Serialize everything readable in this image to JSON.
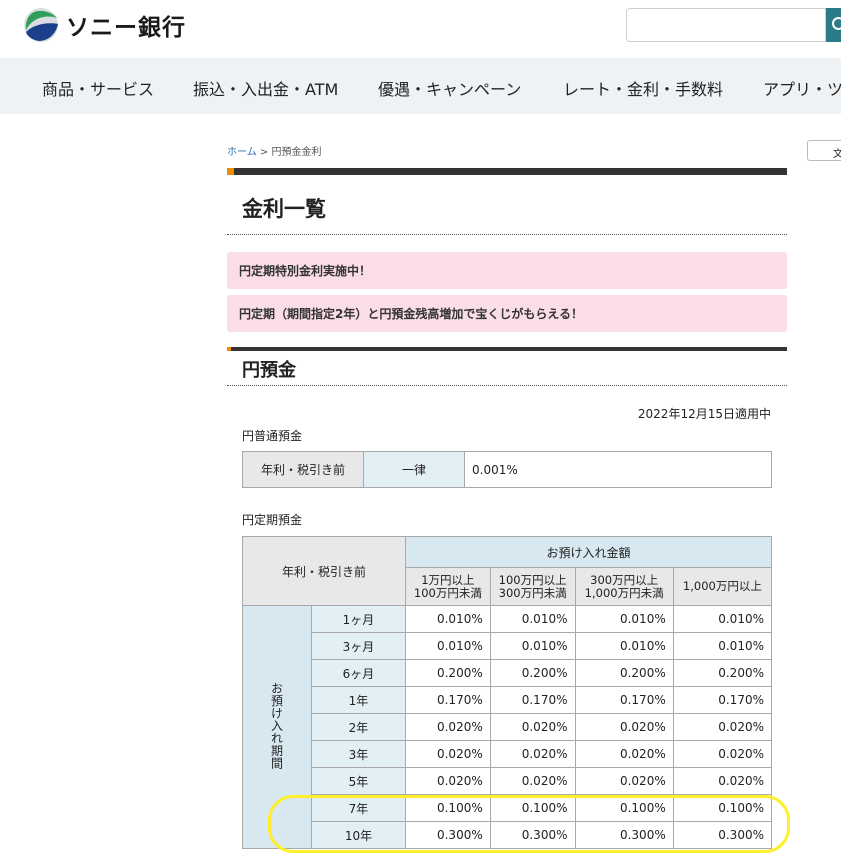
{
  "header": {
    "logo_text": "ソニー銀行",
    "search_placeholder": ""
  },
  "nav": {
    "items": [
      "商品・サービス",
      "振込・入出金・ATM",
      "優遇・キャンペーン",
      "レート・金利・手数料",
      "アプリ・ツ"
    ]
  },
  "side_button_label": "文",
  "breadcrumb": {
    "home": "ホーム",
    "separator": ">",
    "current": "円預金金利"
  },
  "page_title": "金利一覧",
  "notices": [
    "円定期特別金利実施中！",
    "円定期（期間指定2年）と円預金残高増加で宝くじがもらえる！"
  ],
  "section": {
    "title": "円預金",
    "date": "2022年12月15日適用中"
  },
  "ordinary": {
    "title": "円普通預金",
    "header": "年利・税引き前",
    "label": "一律",
    "rate": "0.001%"
  },
  "fixed": {
    "title": "円定期預金",
    "header": "年利・税引き前",
    "amount_header": "お預け入れ金額",
    "period_header": "お預け入れ期間",
    "columns": [
      {
        "line1": "1万円以上",
        "line2": "100万円未満"
      },
      {
        "line1": "100万円以上",
        "line2": "300万円未満"
      },
      {
        "line1": "300万円以上",
        "line2": "1,000万円未満"
      },
      {
        "line1": "1,000万円以上",
        "line2": ""
      }
    ],
    "rows": [
      {
        "term": "1ヶ月",
        "rates": [
          "0.010%",
          "0.010%",
          "0.010%",
          "0.010%"
        ]
      },
      {
        "term": "3ヶ月",
        "rates": [
          "0.010%",
          "0.010%",
          "0.010%",
          "0.010%"
        ]
      },
      {
        "term": "6ヶ月",
        "rates": [
          "0.200%",
          "0.200%",
          "0.200%",
          "0.200%"
        ]
      },
      {
        "term": "1年",
        "rates": [
          "0.170%",
          "0.170%",
          "0.170%",
          "0.170%"
        ]
      },
      {
        "term": "2年",
        "rates": [
          "0.020%",
          "0.020%",
          "0.020%",
          "0.020%"
        ]
      },
      {
        "term": "3年",
        "rates": [
          "0.020%",
          "0.020%",
          "0.020%",
          "0.020%"
        ]
      },
      {
        "term": "5年",
        "rates": [
          "0.020%",
          "0.020%",
          "0.020%",
          "0.020%"
        ]
      },
      {
        "term": "7年",
        "rates": [
          "0.100%",
          "0.100%",
          "0.100%",
          "0.100%"
        ]
      },
      {
        "term": "10年",
        "rates": [
          "0.300%",
          "0.300%",
          "0.300%",
          "0.300%"
        ]
      }
    ]
  },
  "colors": {
    "accent": "#f08c00",
    "search_button": "#2b7c86",
    "notice_bg": "#fbdde9",
    "annotation": "#ffef2a"
  }
}
